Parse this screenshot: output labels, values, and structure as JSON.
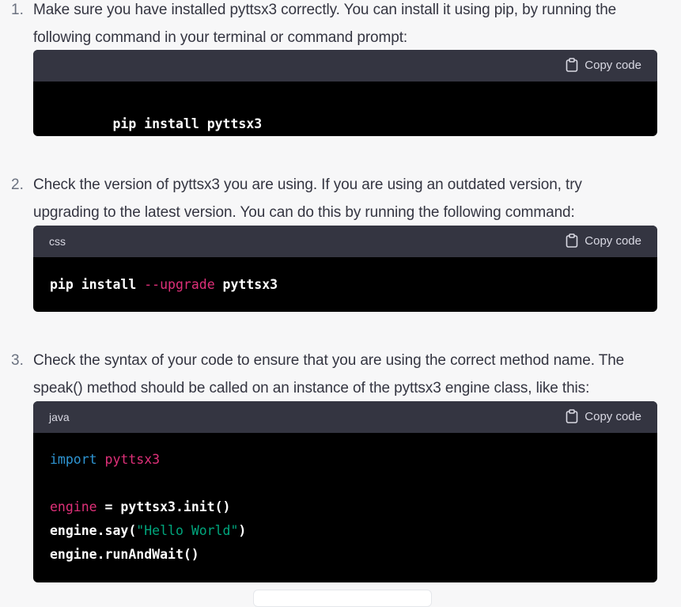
{
  "steps": [
    {
      "number": "1.",
      "text_line1": "Make sure you have installed pyttsx3 correctly. You can install it using pip, by running the",
      "text_line2": "following command in your terminal or command prompt:",
      "code": {
        "language": "",
        "copy_label": "Copy code",
        "line1": "pip install pyttsx3"
      }
    },
    {
      "number": "2.",
      "text_line1": "Check the version of pyttsx3 you are using. If you are using an outdated version, try",
      "text_line2": "upgrading to the latest version. You can do this by running the following command:",
      "code": {
        "language": "css",
        "copy_label": "Copy code",
        "part_cmd": "pip install ",
        "part_flag": "--upgrade",
        "part_pkg": " pyttsx3"
      }
    },
    {
      "number": "3.",
      "text_line1": "Check the syntax of your code to ensure that you are using the correct method name. The",
      "text_line2": "speak() method should be called on an instance of the pyttsx3 engine class, like this:",
      "code": {
        "language": "java",
        "copy_label": "Copy code",
        "import_kw": "import",
        "import_name": " pyttsx3",
        "engine_var": "engine",
        "engine_assign": " = pyttsx3.init()",
        "say_call": "engine.say(",
        "say_str": "\"Hello World\"",
        "say_close": ")",
        "run_call": "engine.runAndWait()"
      }
    }
  ],
  "icons": {
    "copy": "clipboard-icon"
  },
  "colors": {
    "page_bg": "#f7f7f8",
    "code_header_bg": "#343541",
    "code_bg": "#000000",
    "keyword": "#2e95d3",
    "name": "#df3079",
    "string": "#00a67d"
  }
}
